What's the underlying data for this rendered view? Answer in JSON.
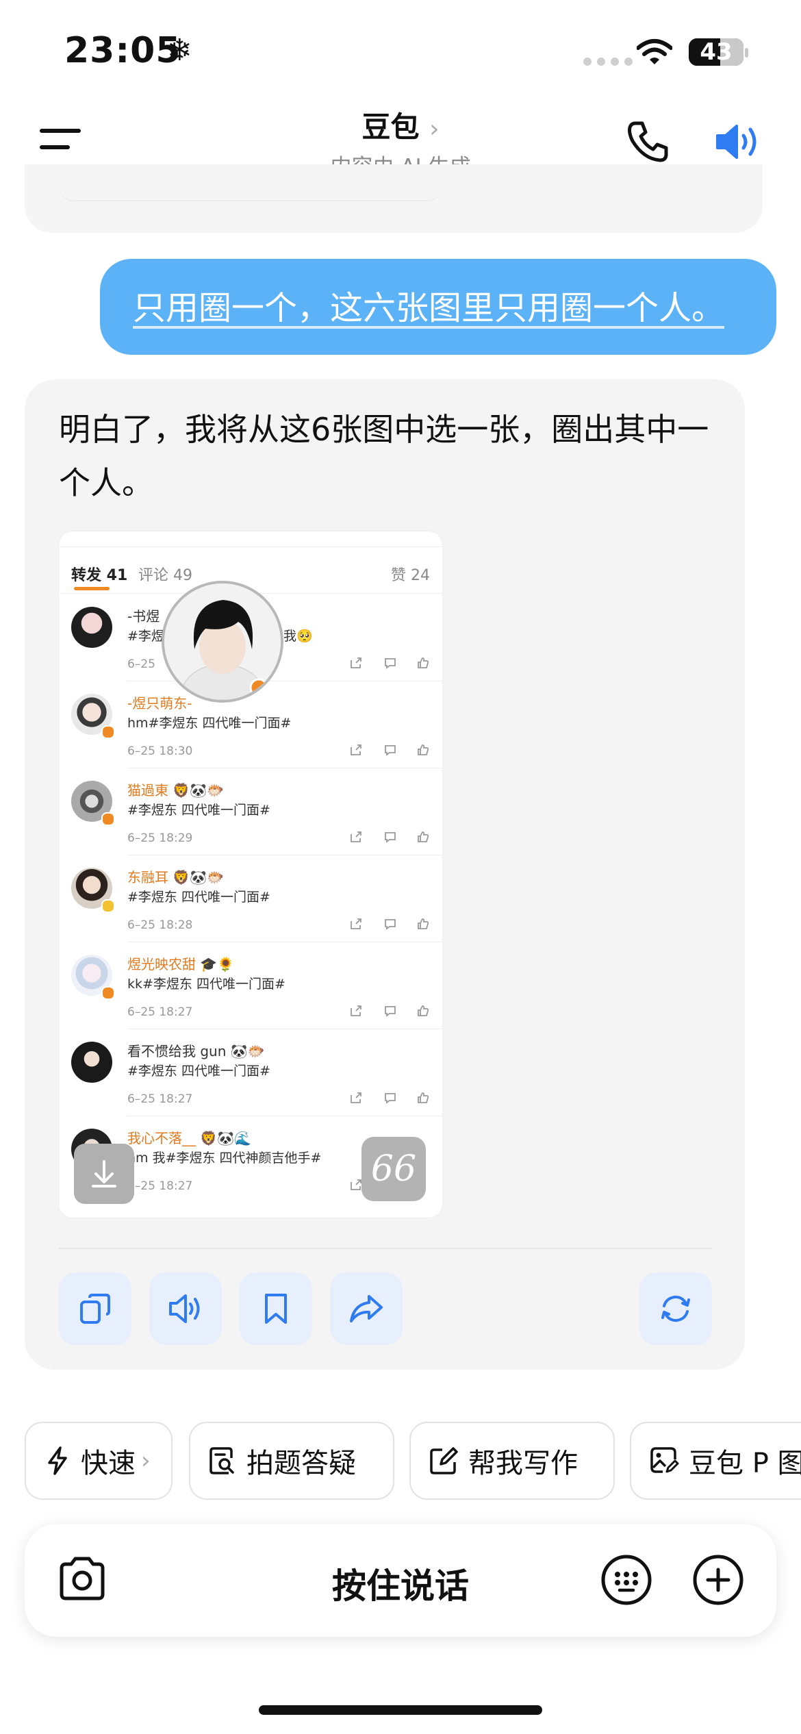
{
  "status_bar": {
    "time": "23:05",
    "snow_symbol": "❄",
    "battery": "43"
  },
  "header": {
    "title": "豆包",
    "title_chevron": "›",
    "subtitle": "内容由 AI 生成"
  },
  "conversation": {
    "user_message": "只用圈一个，这六张图里只用圈一个人。",
    "ai_message": "明白了，我将从这6张图中选一张，圈出其中一个人。"
  },
  "image": {
    "tabs": {
      "repost_label": "转发 41",
      "comment_label": "评论 49",
      "like_label": "赞 24"
    },
    "rows": [
      {
        "name": "-书煜",
        "content": "#李煜",
        "content_tail": "我🥺",
        "time": "6–25"
      },
      {
        "name": "-煜只萌东-",
        "content": "hm#李煜东 四代唯一门面#",
        "time": "6–25 18:30"
      },
      {
        "name": "猫過東 🦁🐼🐡",
        "content": "#李煜东 四代唯一门面#",
        "time": "6–25 18:29"
      },
      {
        "name": "东融耳 🦁🐼🐡",
        "content": "#李煜东 四代唯一门面#",
        "time": "6–25 18:28"
      },
      {
        "name": "煜光映农甜 🎓🌻",
        "content": "kk#李煜东 四代唯一门面#",
        "time": "6–25 18:27"
      },
      {
        "name": "看不惯给我 gun 🐼🐡",
        "content": "#李煜东 四代唯一门面#",
        "time": "6–25 18:27"
      },
      {
        "name": "我心不落__ 🦁🐼🌊",
        "content": "hm 我#李煜东 四代神颜吉他手#",
        "time": "6–25 18:27"
      }
    ],
    "quote_label": "66"
  },
  "shortcuts": [
    {
      "label": "快速",
      "chevron": "›"
    },
    {
      "label": "拍题答疑"
    },
    {
      "label": "帮我写作"
    },
    {
      "label": "豆包 P 图"
    }
  ],
  "input": {
    "hold_to_talk": "按住说话"
  },
  "colors": {
    "user_bubble": "#5bb2f7",
    "accent": "#2f7bf2",
    "action_bg": "#e6effb",
    "weibo_orange": "#f08a24"
  }
}
